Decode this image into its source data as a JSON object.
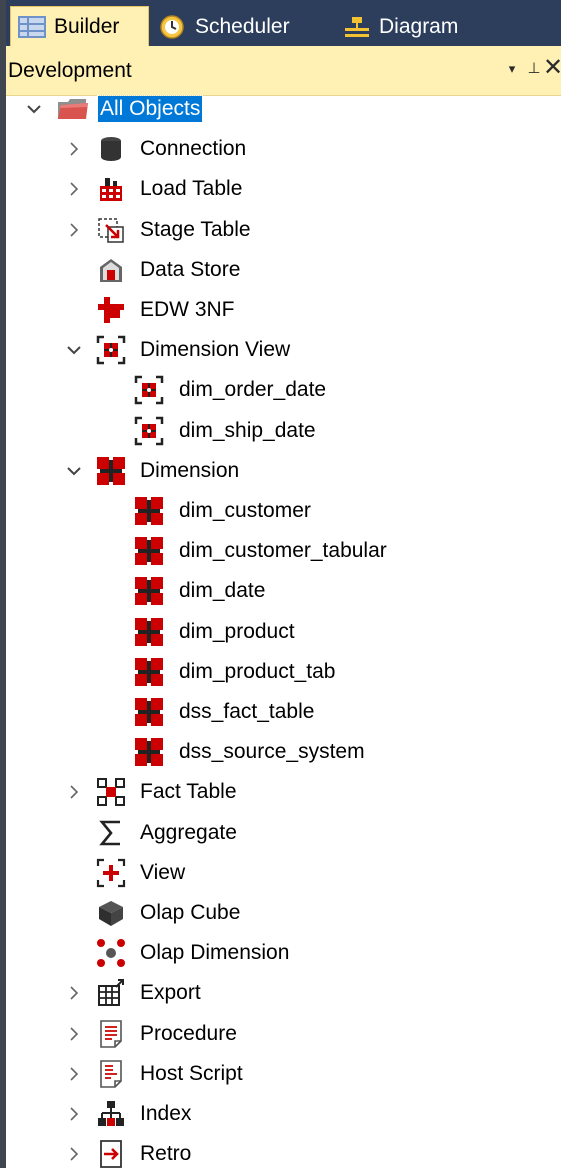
{
  "tabs": [
    {
      "label": "Builder",
      "icon": "builder-icon",
      "active": true
    },
    {
      "label": "Scheduler",
      "icon": "scheduler-icon",
      "active": false
    },
    {
      "label": "Diagram",
      "icon": "diagram-icon",
      "active": false
    }
  ],
  "panel": {
    "title": "Development",
    "dropdown_glyph": "▾",
    "pin_glyph": "⊥",
    "close_glyph": "✕"
  },
  "colors": {
    "tab_strip": "#2c3e5c",
    "active_tab": "#fff0b3",
    "selection": "#0078d7",
    "icon_red": "#cc0000"
  },
  "tree": {
    "root": {
      "label": "All Objects",
      "expanded": true,
      "selected": true,
      "icon": "folder-icon"
    },
    "items": [
      {
        "key": "connection",
        "label": "Connection",
        "expander": "collapsed",
        "icon": "connection-icon"
      },
      {
        "key": "load-table",
        "label": "Load Table",
        "expander": "collapsed",
        "icon": "load-table-icon"
      },
      {
        "key": "stage-table",
        "label": "Stage Table",
        "expander": "collapsed",
        "icon": "stage-table-icon"
      },
      {
        "key": "data-store",
        "label": "Data Store",
        "expander": "none",
        "icon": "data-store-icon"
      },
      {
        "key": "edw-3nf",
        "label": "EDW 3NF",
        "expander": "none",
        "icon": "edw-3nf-icon"
      },
      {
        "key": "dimension-view",
        "label": "Dimension View",
        "expander": "expanded",
        "icon": "dimension-view-icon",
        "children": [
          {
            "label": "dim_order_date",
            "icon": "dimension-view-icon"
          },
          {
            "label": "dim_ship_date",
            "icon": "dimension-view-icon"
          }
        ]
      },
      {
        "key": "dimension",
        "label": "Dimension",
        "expander": "expanded",
        "icon": "dimension-icon",
        "children": [
          {
            "label": "dim_customer",
            "icon": "dimension-icon"
          },
          {
            "label": "dim_customer_tabular",
            "icon": "dimension-icon"
          },
          {
            "label": "dim_date",
            "icon": "dimension-icon"
          },
          {
            "label": "dim_product",
            "icon": "dimension-icon"
          },
          {
            "label": "dim_product_tab",
            "icon": "dimension-icon"
          },
          {
            "label": "dss_fact_table",
            "icon": "dimension-icon"
          },
          {
            "label": "dss_source_system",
            "icon": "dimension-icon"
          }
        ]
      },
      {
        "key": "fact-table",
        "label": "Fact Table",
        "expander": "collapsed",
        "icon": "fact-table-icon"
      },
      {
        "key": "aggregate",
        "label": "Aggregate",
        "expander": "none",
        "icon": "sigma-icon"
      },
      {
        "key": "view",
        "label": "View",
        "expander": "none",
        "icon": "view-icon"
      },
      {
        "key": "olap-cube",
        "label": "Olap Cube",
        "expander": "none",
        "icon": "cube-icon"
      },
      {
        "key": "olap-dimension",
        "label": "Olap Dimension",
        "expander": "none",
        "icon": "olap-dimension-icon"
      },
      {
        "key": "export",
        "label": "Export",
        "expander": "collapsed",
        "icon": "export-icon"
      },
      {
        "key": "procedure",
        "label": "Procedure",
        "expander": "collapsed",
        "icon": "procedure-icon"
      },
      {
        "key": "host-script",
        "label": "Host Script",
        "expander": "collapsed",
        "icon": "host-script-icon"
      },
      {
        "key": "index",
        "label": "Index",
        "expander": "collapsed",
        "icon": "index-icon"
      },
      {
        "key": "retro",
        "label": "Retro",
        "expander": "collapsed",
        "icon": "retro-icon"
      }
    ]
  }
}
